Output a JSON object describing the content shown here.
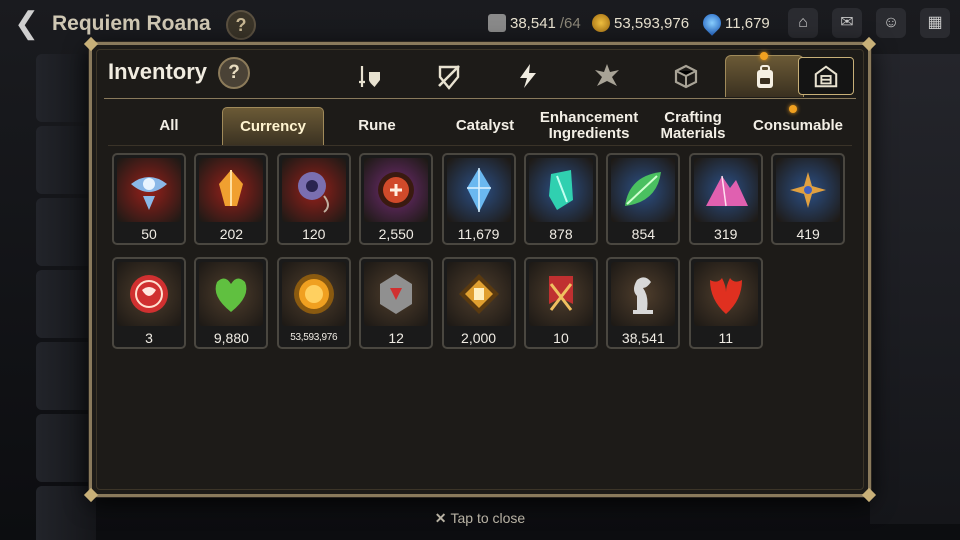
{
  "header": {
    "hero_name": "Requiem Roana",
    "help_icon": "?",
    "stamina": "38,541",
    "stamina_max": "/64",
    "gold": "53,593,976",
    "skystone": "11,679"
  },
  "modal": {
    "title": "Inventory",
    "help_label": "?",
    "category_tabs": [
      {
        "name": "equipment",
        "icon": "sword-shield-icon"
      },
      {
        "name": "artifact",
        "icon": "broken-shield-icon"
      },
      {
        "name": "catalyst",
        "icon": "lightning-icon"
      },
      {
        "name": "materials",
        "icon": "crystal-burst-icon"
      },
      {
        "name": "gift",
        "icon": "box-icon"
      },
      {
        "name": "backpack",
        "icon": "backpack-icon",
        "active": true
      }
    ],
    "extra_tab_icon": "storage-house-icon",
    "sub_tabs": [
      {
        "label": "All",
        "active": false
      },
      {
        "label": "Currency",
        "active": true
      },
      {
        "label": "Rune",
        "active": false
      },
      {
        "label": "Catalyst",
        "active": false
      },
      {
        "label": "Enhancement Ingredients",
        "active": false
      },
      {
        "label": "Crafting Materials",
        "active": false
      },
      {
        "label": "Consumable",
        "active": false
      }
    ],
    "items": [
      {
        "icon": "eye-emblem-icon",
        "qty": "50",
        "bg": "#8a1f1a",
        "color": "#8ab8e8"
      },
      {
        "icon": "amber-crystal-icon",
        "qty": "202",
        "bg": "#8a1f1a",
        "color": "#f0a030"
      },
      {
        "icon": "pendant-icon",
        "qty": "120",
        "bg": "#8a1f1a",
        "color": "#7a6fb0"
      },
      {
        "icon": "red-coin-icon",
        "qty": "2,550",
        "bg": "#6a2a6a",
        "color": "#d04a2a"
      },
      {
        "icon": "blue-crystal-icon",
        "qty": "11,679",
        "bg": "#2a4a7a",
        "color": "#6ab8f0"
      },
      {
        "icon": "teal-crystal-icon",
        "qty": "878",
        "bg": "#2a4a7a",
        "color": "#30d0b0"
      },
      {
        "icon": "leaf-icon",
        "qty": "854",
        "bg": "#2a4a7a",
        "color": "#4ac060"
      },
      {
        "icon": "pink-mountain-icon",
        "qty": "319",
        "bg": "#2a4a7a",
        "color": "#e060b0"
      },
      {
        "icon": "star-pendant-icon",
        "qty": "419",
        "bg": "#2a4a7a",
        "color": "#e0a040"
      },
      {
        "icon": "red-medal-icon",
        "qty": "3",
        "bg": "#4a3a2a",
        "color": "#d03030"
      },
      {
        "icon": "green-heart-icon",
        "qty": "9,880",
        "bg": "#4a3a2a",
        "color": "#60c040"
      },
      {
        "icon": "gold-coin-icon",
        "qty": "53,593,976",
        "bg": "#4a3a2a",
        "color": "#f0a020",
        "small": true
      },
      {
        "icon": "stone-rune-icon",
        "qty": "12",
        "bg": "#4a3a2a",
        "color": "#909090"
      },
      {
        "icon": "gold-fist-emblem-icon",
        "qty": "2,000",
        "bg": "#4a3a2a",
        "color": "#e0a030"
      },
      {
        "icon": "red-banner-icon",
        "qty": "10",
        "bg": "#4a3a2a",
        "color": "#c03030"
      },
      {
        "icon": "silver-horse-icon",
        "qty": "38,541",
        "bg": "#4a3a2a",
        "color": "#d8d8d8"
      },
      {
        "icon": "red-wing-icon",
        "qty": "11",
        "bg": "#4a3a2a",
        "color": "#e03020"
      }
    ]
  },
  "footer": {
    "close_tip": "Tap to close"
  }
}
